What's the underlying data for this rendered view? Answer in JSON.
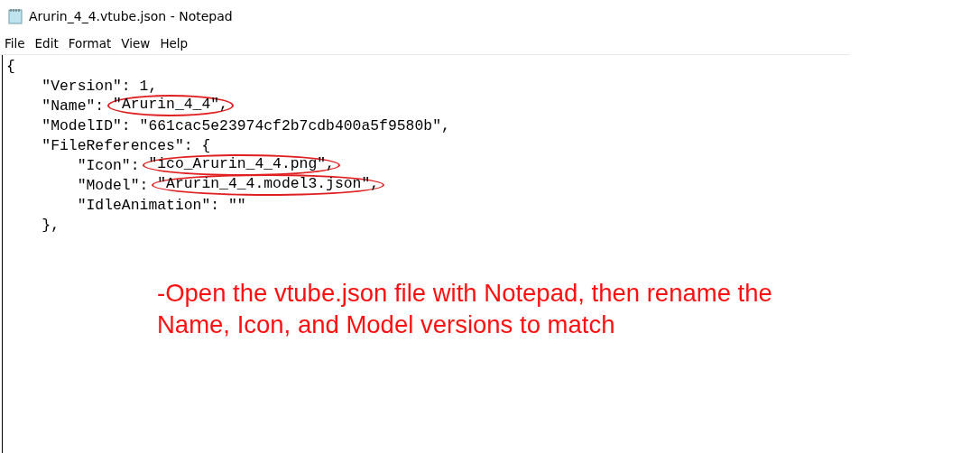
{
  "window": {
    "title": "Arurin_4_4.vtube.json - Notepad"
  },
  "menu": [
    "File",
    "Edit",
    "Format",
    "View",
    "Help"
  ],
  "lines": [
    {
      "code": "{"
    },
    {
      "code": "    \"Version\": 1,"
    },
    {
      "code": "    \"Name\": ",
      "circled": "\"Arurin_4_4\","
    },
    {
      "code": "    \"ModelID\": \"661cac5e23974cf2b7cdb400a5f9580b\","
    },
    {
      "code": "    \"FileReferences\": {"
    },
    {
      "code": "        \"Icon\": ",
      "circled": "\"ico_Arurin_4_4.png\","
    },
    {
      "code": "        \"Model\": ",
      "circled": "\"Arurin_4_4.model3.json\","
    },
    {
      "code": "        \"IdleAnimation\": \"\""
    },
    {
      "code": "    },"
    }
  ],
  "annotation": "-Open the vtube.json file with Notepad, then rename the Name, Icon, and Model versions to match"
}
